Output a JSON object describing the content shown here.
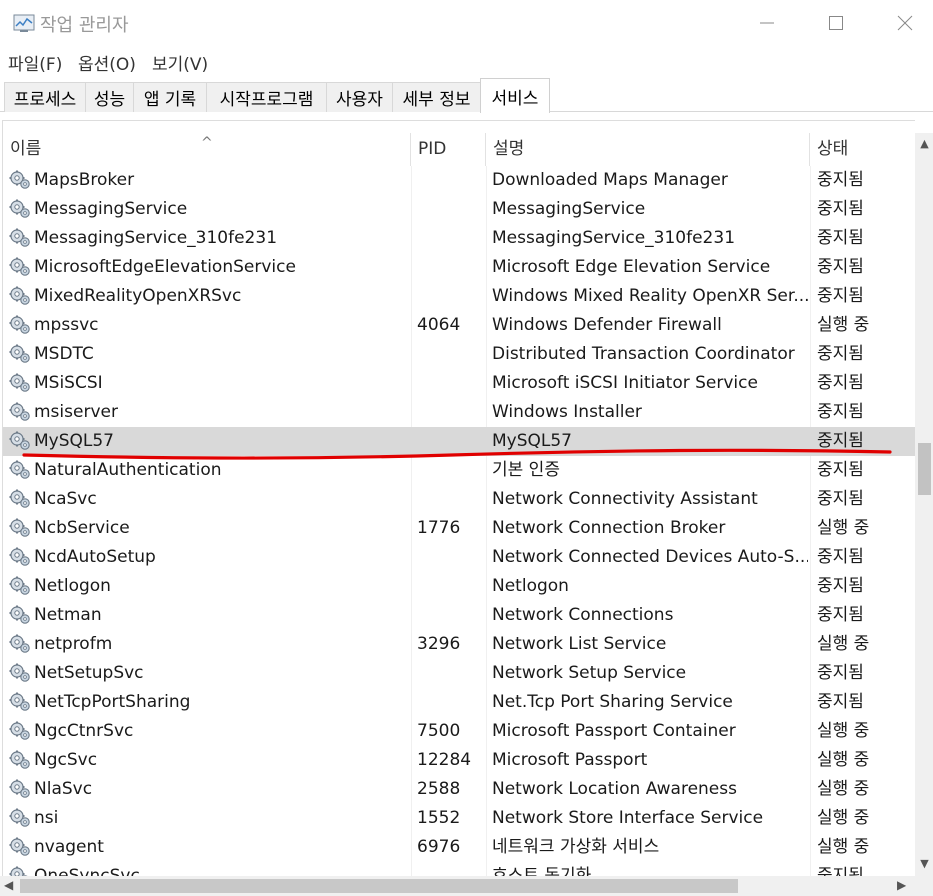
{
  "window": {
    "title": "작업 관리자",
    "icon": "task-manager-icon",
    "controls": [
      "minimize-icon",
      "maximize-icon",
      "close-icon"
    ]
  },
  "menu": [
    {
      "label": "파일(F)"
    },
    {
      "label": "옵션(O)"
    },
    {
      "label": "보기(V)"
    }
  ],
  "tabs": [
    {
      "label": "프로세스"
    },
    {
      "label": "성능"
    },
    {
      "label": "앱 기록"
    },
    {
      "label": "시작프로그램"
    },
    {
      "label": "사용자"
    },
    {
      "label": "세부 정보"
    },
    {
      "label": "서비스",
      "active": true
    }
  ],
  "columns": {
    "name": "이름",
    "pid": "PID",
    "description": "설명",
    "status": "상태",
    "sort_indicator": "^"
  },
  "services": [
    {
      "name": "MapsBroker",
      "pid": "",
      "description": "Downloaded Maps Manager",
      "status": "중지됨"
    },
    {
      "name": "MessagingService",
      "pid": "",
      "description": "MessagingService",
      "status": "중지됨"
    },
    {
      "name": "MessagingService_310fe231",
      "pid": "",
      "description": "MessagingService_310fe231",
      "status": "중지됨"
    },
    {
      "name": "MicrosoftEdgeElevationService",
      "pid": "",
      "description": "Microsoft Edge Elevation Service",
      "status": "중지됨"
    },
    {
      "name": "MixedRealityOpenXRSvc",
      "pid": "",
      "description": "Windows Mixed Reality OpenXR Ser...",
      "status": "중지됨"
    },
    {
      "name": "mpssvc",
      "pid": "4064",
      "description": "Windows Defender Firewall",
      "status": "실행 중"
    },
    {
      "name": "MSDTC",
      "pid": "",
      "description": "Distributed Transaction Coordinator",
      "status": "중지됨"
    },
    {
      "name": "MSiSCSI",
      "pid": "",
      "description": "Microsoft iSCSI Initiator Service",
      "status": "중지됨"
    },
    {
      "name": "msiserver",
      "pid": "",
      "description": "Windows Installer",
      "status": "중지됨"
    },
    {
      "name": "MySQL57",
      "pid": "",
      "description": "MySQL57",
      "status": "중지됨",
      "selected": true
    },
    {
      "name": "NaturalAuthentication",
      "pid": "",
      "description": "기본 인증",
      "status": "중지됨"
    },
    {
      "name": "NcaSvc",
      "pid": "",
      "description": "Network Connectivity Assistant",
      "status": "중지됨"
    },
    {
      "name": "NcbService",
      "pid": "1776",
      "description": "Network Connection Broker",
      "status": "실행 중"
    },
    {
      "name": "NcdAutoSetup",
      "pid": "",
      "description": "Network Connected Devices Auto-S...",
      "status": "중지됨"
    },
    {
      "name": "Netlogon",
      "pid": "",
      "description": "Netlogon",
      "status": "중지됨"
    },
    {
      "name": "Netman",
      "pid": "",
      "description": "Network Connections",
      "status": "중지됨"
    },
    {
      "name": "netprofm",
      "pid": "3296",
      "description": "Network List Service",
      "status": "실행 중"
    },
    {
      "name": "NetSetupSvc",
      "pid": "",
      "description": "Network Setup Service",
      "status": "중지됨"
    },
    {
      "name": "NetTcpPortSharing",
      "pid": "",
      "description": "Net.Tcp Port Sharing Service",
      "status": "중지됨"
    },
    {
      "name": "NgcCtnrSvc",
      "pid": "7500",
      "description": "Microsoft Passport Container",
      "status": "실행 중"
    },
    {
      "name": "NgcSvc",
      "pid": "12284",
      "description": "Microsoft Passport",
      "status": "실행 중"
    },
    {
      "name": "NlaSvc",
      "pid": "2588",
      "description": "Network Location Awareness",
      "status": "실행 중"
    },
    {
      "name": "nsi",
      "pid": "1552",
      "description": "Network Store Interface Service",
      "status": "실행 중"
    },
    {
      "name": "nvagent",
      "pid": "6976",
      "description": "네트워크 가상화 서비스",
      "status": "실행 중"
    },
    {
      "name": "OneSyncSvc",
      "pid": "",
      "description": "호스트 동기화",
      "status": "중지됨"
    }
  ],
  "annotation_color": "#e00000"
}
